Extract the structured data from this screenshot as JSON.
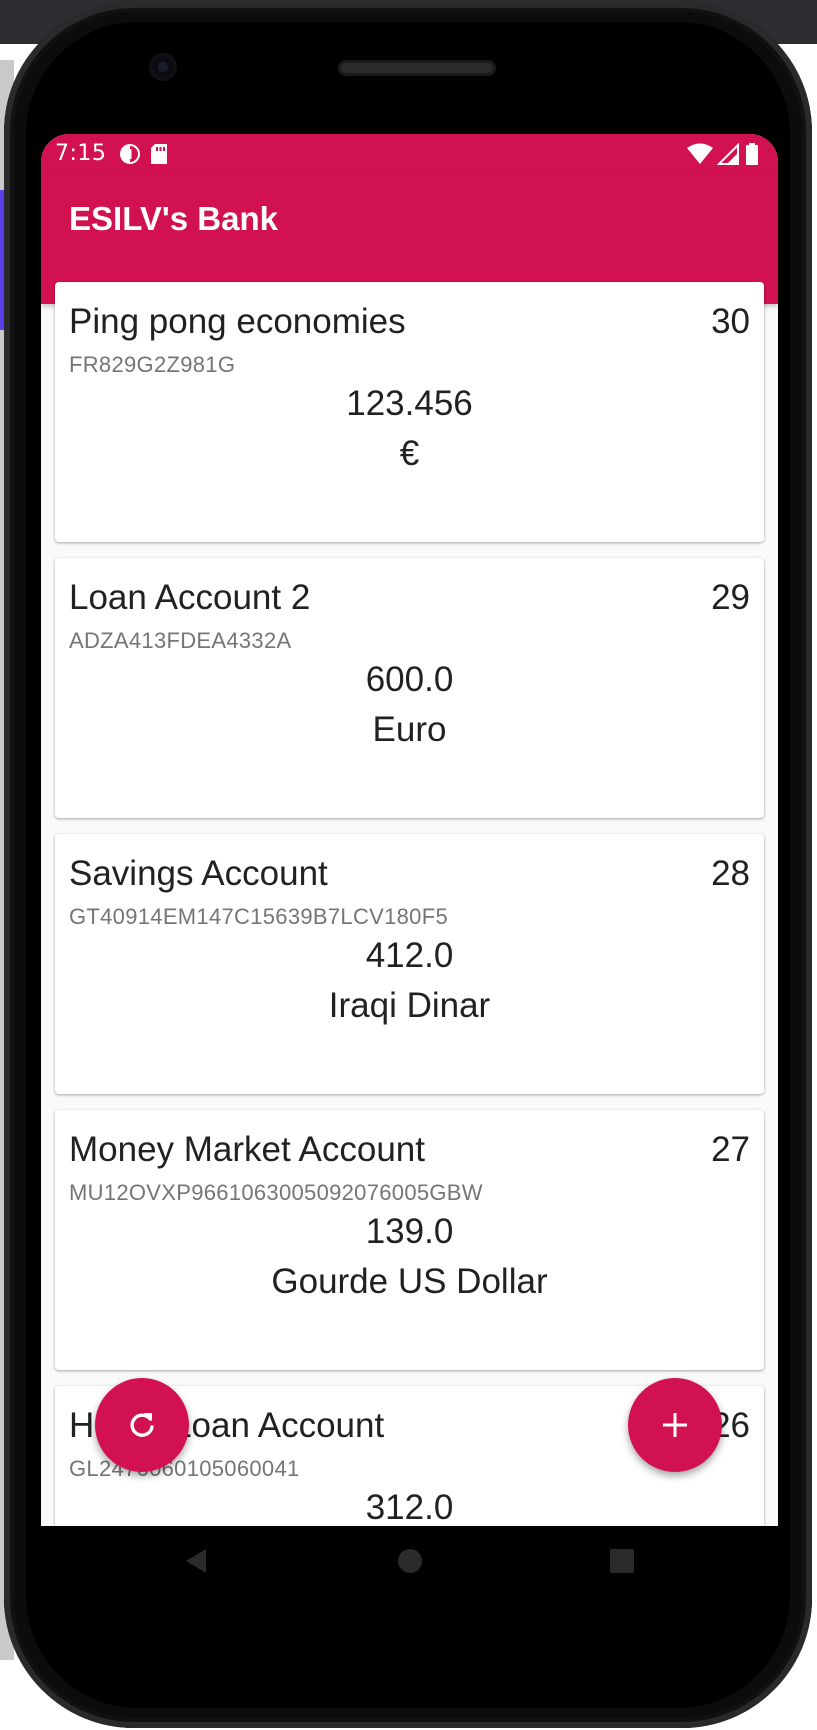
{
  "status_bar": {
    "time": "7:15",
    "icons": [
      "data-saver-icon",
      "sd-card-icon",
      "wifi-icon",
      "signal-icon",
      "battery-icon"
    ]
  },
  "app_bar": {
    "title": "ESILV's Bank"
  },
  "accounts": [
    {
      "name": "Ping pong economies",
      "id": "30",
      "iban": "FR829G2Z981G",
      "amount": "123.456",
      "currency": "€"
    },
    {
      "name": "Loan Account 2",
      "id": "29",
      "iban": "ADZA413FDEA4332A",
      "amount": "600.0",
      "currency": "Euro"
    },
    {
      "name": "Savings Account",
      "id": "28",
      "iban": "GT40914EM147C15639B7LCV180F5",
      "amount": "412.0",
      "currency": "Iraqi Dinar"
    },
    {
      "name": "Money Market Account",
      "id": "27",
      "iban": "MU12OVXP9661063005092076005GBW",
      "amount": "139.0",
      "currency": "Gourde US Dollar"
    },
    {
      "name": "Home Loan Account",
      "id": "26",
      "iban": "GL2476060105060041",
      "amount": "312.0",
      "currency": ""
    }
  ],
  "fabs": {
    "refresh_icon": "refresh-icon",
    "add_icon": "plus-icon"
  },
  "colors": {
    "primary": "#d21250",
    "background": "#fafafa",
    "card": "#ffffff",
    "text_primary": "#212121",
    "text_secondary": "#757575"
  }
}
